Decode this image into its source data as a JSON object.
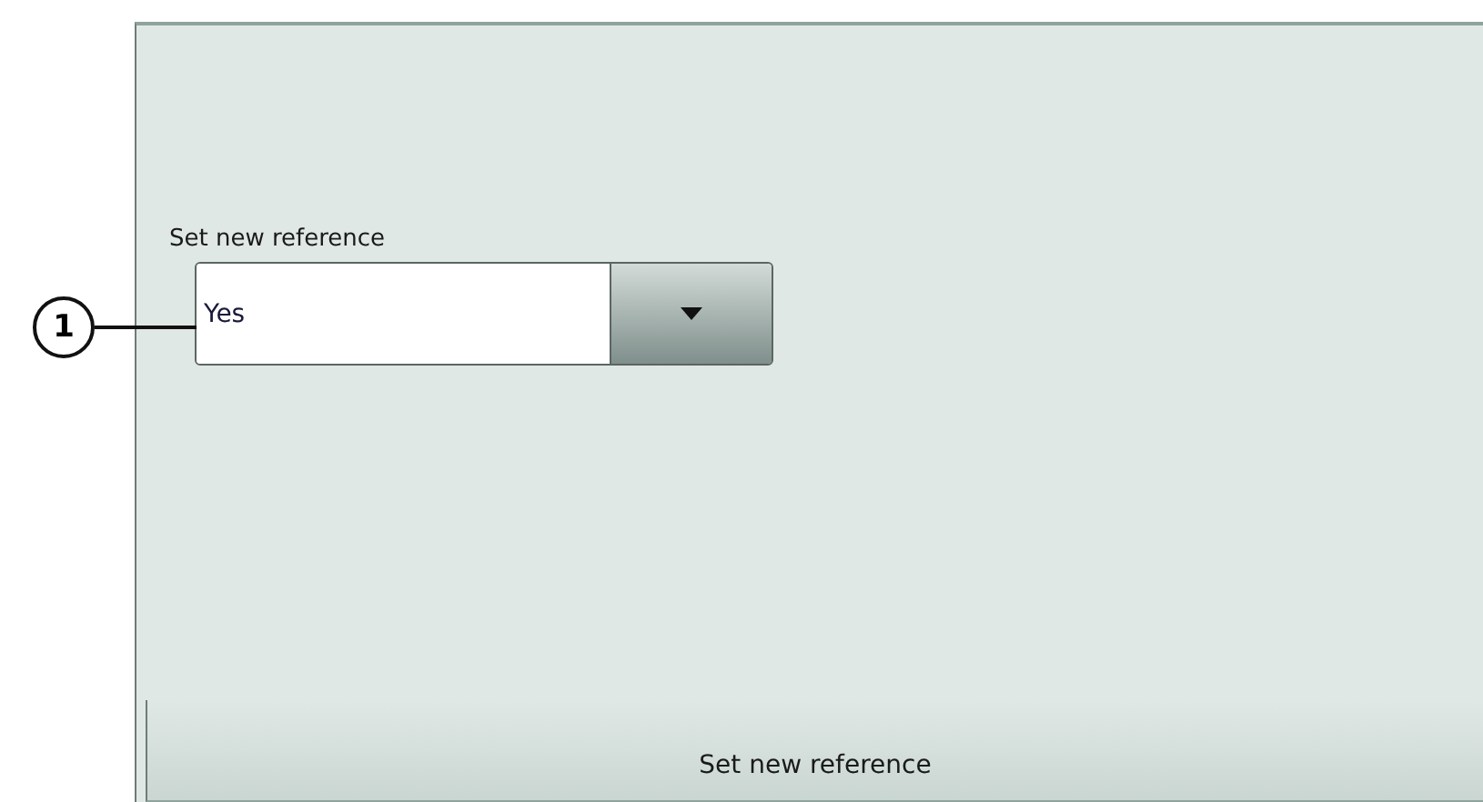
{
  "callout": {
    "number": "1"
  },
  "panel": {
    "field": {
      "label": "Set new reference",
      "value": "Yes"
    },
    "action_button": {
      "label": "Set new reference"
    }
  }
}
